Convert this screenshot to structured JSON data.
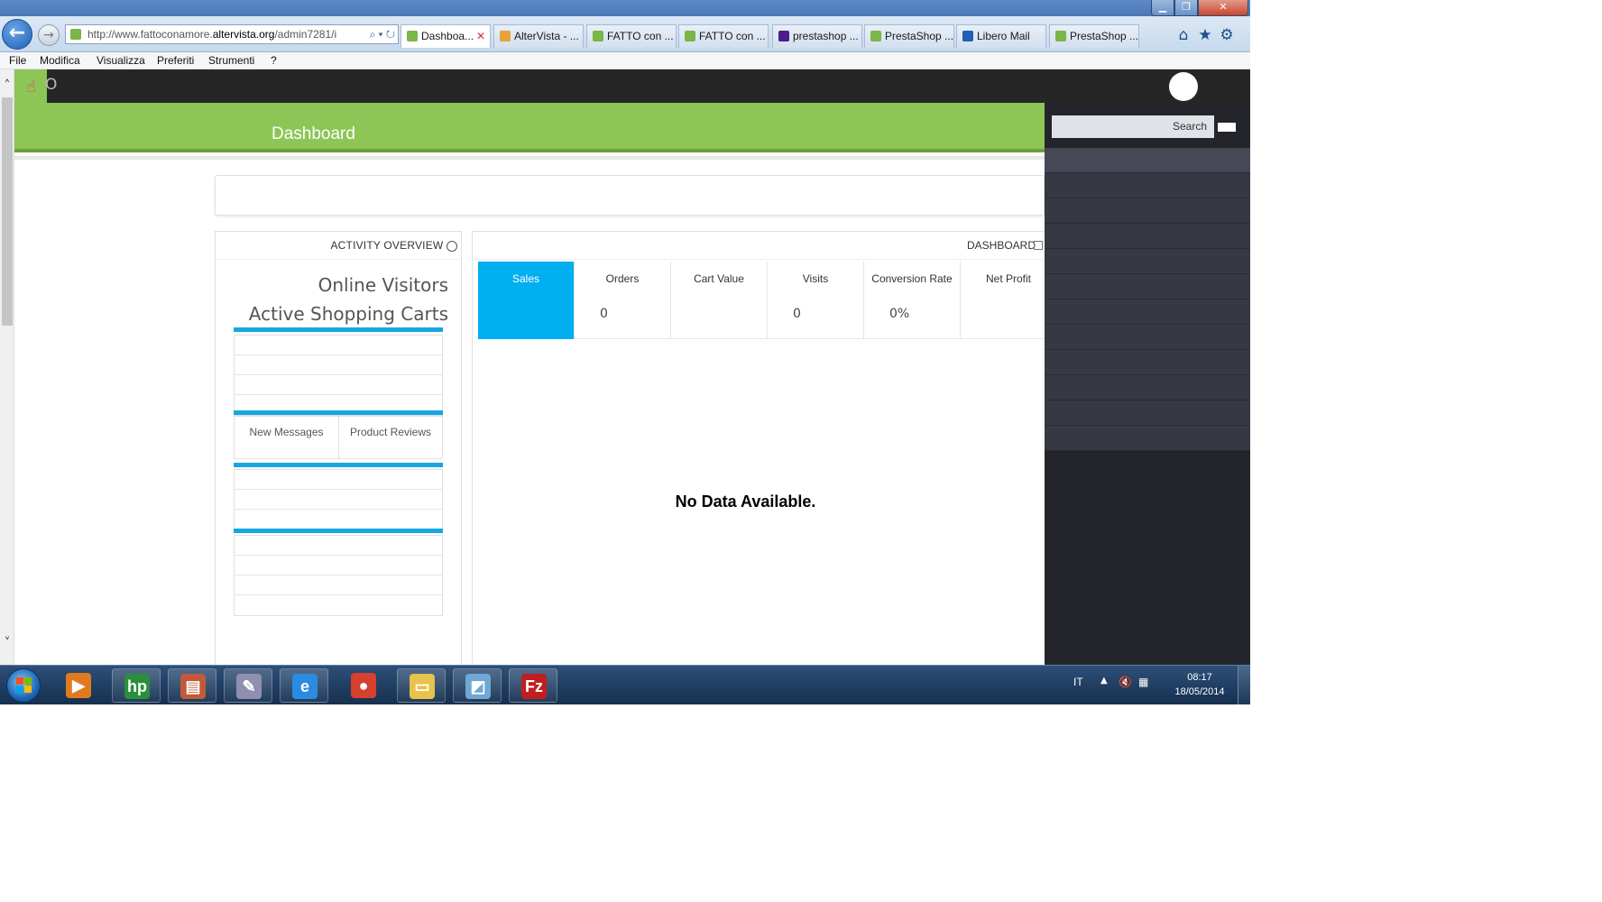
{
  "window": {
    "minimize_label": "▁",
    "maximize_label": "❐",
    "close_label": "✕"
  },
  "browser": {
    "address_prefix": "http://www.fattoconamore.",
    "address_domain": "altervista.org",
    "address_suffix": "/admin7281/i",
    "address_icons": "⌕ ▾ ↻",
    "tabs": [
      {
        "label": "Dashboa...",
        "color": "#7ab648",
        "active": true
      },
      {
        "label": "AlterVista - ...",
        "color": "#e8a23a"
      },
      {
        "label": "FATTO con ...",
        "color": "#7ab648"
      },
      {
        "label": "FATTO con ...",
        "color": "#7ab648"
      },
      {
        "label": "prestashop ...",
        "color": "#4b1e8a"
      },
      {
        "label": "PrestaShop ...",
        "color": "#7ab648"
      },
      {
        "label": "Libero Mail",
        "color": "#1e5fb4"
      },
      {
        "label": "PrestaShop ...",
        "color": "#7ab648"
      }
    ],
    "tab_close": "✕"
  },
  "menubar": {
    "items": [
      "File",
      "Modifica",
      "Visualizza",
      "Preferiti",
      "Strumenti",
      "?"
    ]
  },
  "admin": {
    "logo_text": "O",
    "page_title": "Dashboard",
    "sidebar": {
      "search_label": "Search",
      "item_count": 12
    },
    "activity": {
      "title": "ACTIVITY OVERVIEW",
      "online_visitors": "Online Visitors",
      "active_carts": "Active Shopping Carts",
      "new_messages": "New Messages",
      "product_reviews": "Product Reviews"
    },
    "dashboard": {
      "title": "DASHBOARD",
      "kpis": [
        {
          "label": "Sales",
          "value": "",
          "active": true
        },
        {
          "label": "Orders",
          "value": "0"
        },
        {
          "label": "Cart Value",
          "value": ""
        },
        {
          "label": "Visits",
          "value": "0"
        },
        {
          "label": "Conversion Rate",
          "value": "0%"
        },
        {
          "label": "Net Profit",
          "value": ""
        }
      ],
      "no_data": "No Data Available."
    }
  },
  "taskbar": {
    "language": "IT",
    "time": "08:17",
    "date": "18/05/2014",
    "apps": [
      {
        "name": "media-player-icon",
        "glyph": "▶",
        "color": "#e07a1f"
      },
      {
        "name": "hp-icon",
        "glyph": "hp",
        "color": "#2a8f3c"
      },
      {
        "name": "scanner-icon",
        "glyph": "▤",
        "color": "#c25a3a"
      },
      {
        "name": "paint-icon",
        "glyph": "✎",
        "color": "#8f8fb0"
      },
      {
        "name": "internet-explorer-icon",
        "glyph": "e",
        "color": "#2b8be0"
      },
      {
        "name": "chrome-icon",
        "glyph": "●",
        "color": "#d6402f"
      },
      {
        "name": "file-explorer-icon",
        "glyph": "▭",
        "color": "#e8c24a"
      },
      {
        "name": "notes-icon",
        "glyph": "◩",
        "color": "#6fa8d6"
      },
      {
        "name": "filezilla-icon",
        "glyph": "Fz",
        "color": "#c01f1f"
      }
    ]
  }
}
